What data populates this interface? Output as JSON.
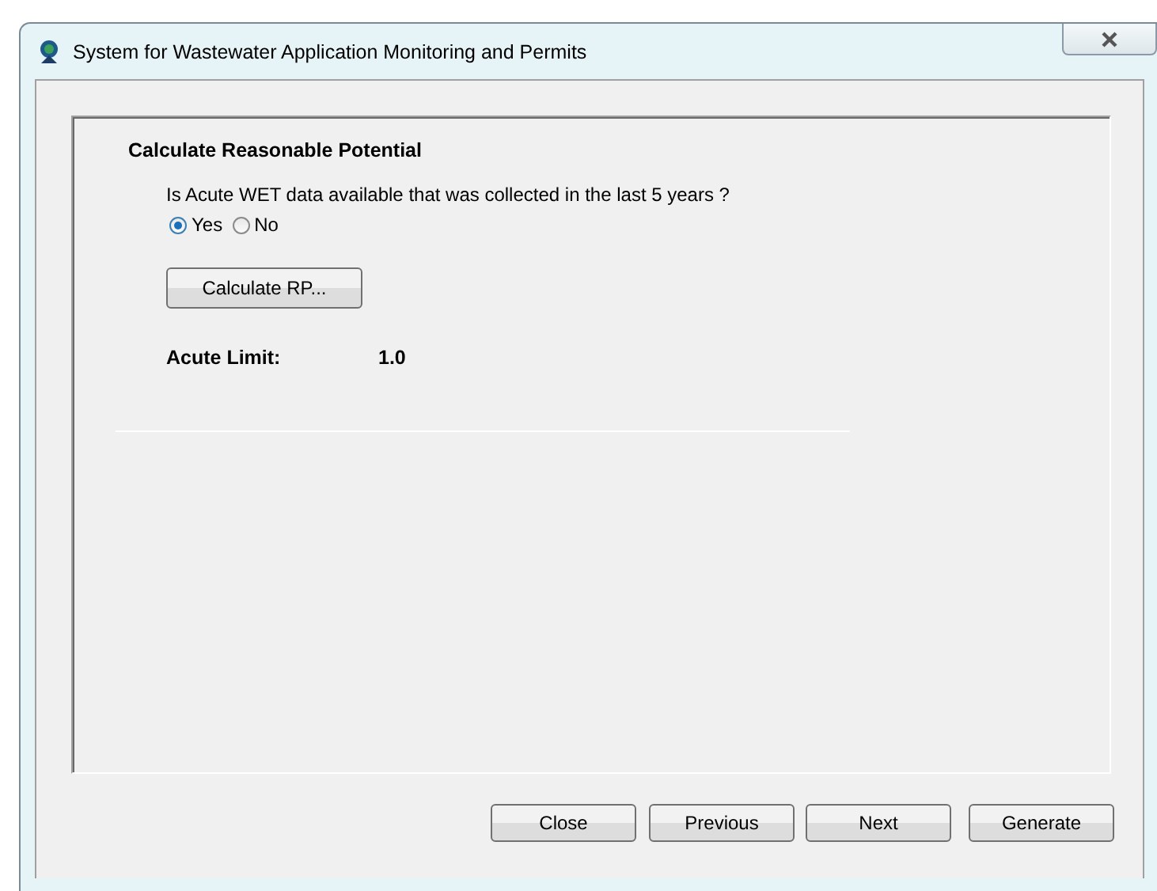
{
  "window": {
    "title": "System for Wastewater Application Monitoring and Permits"
  },
  "section": {
    "title": "Calculate Reasonable Potential"
  },
  "question": "Is Acute WET data available that was collected in the last 5 years ?",
  "options": [
    {
      "label": "Yes",
      "selected": true
    },
    {
      "label": "No",
      "selected": false
    }
  ],
  "calculate_button": "Calculate RP...",
  "result": {
    "label": "Acute Limit:",
    "value": "1.0"
  },
  "buttons": [
    "Close",
    "Previous",
    "Next",
    "Generate"
  ]
}
